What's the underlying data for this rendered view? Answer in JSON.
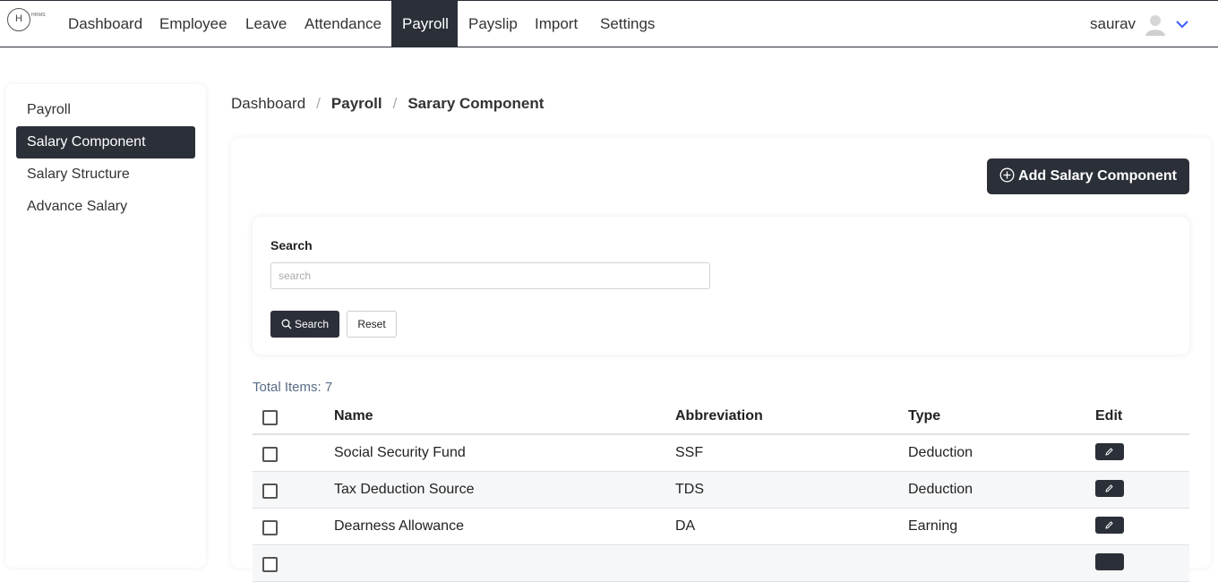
{
  "brand": {
    "logo_letter": "H",
    "logo_text": "HRMS"
  },
  "nav": {
    "items": [
      {
        "label": "Dashboard",
        "active": false
      },
      {
        "label": "Employee",
        "active": false
      },
      {
        "label": "Leave",
        "active": false
      },
      {
        "label": "Attendance",
        "active": false
      },
      {
        "label": "Payroll",
        "active": true
      },
      {
        "label": "Payslip",
        "active": false
      },
      {
        "label": "Import",
        "active": false
      },
      {
        "label": "Settings",
        "active": false
      }
    ],
    "user_name": "saurav"
  },
  "sidebar": {
    "items": [
      {
        "label": "Payroll",
        "active": false
      },
      {
        "label": "Salary Component",
        "active": true
      },
      {
        "label": "Salary Structure",
        "active": false
      },
      {
        "label": "Advance Salary",
        "active": false
      }
    ]
  },
  "breadcrumb": {
    "items": [
      "Dashboard",
      "Payroll",
      "Sarary Component"
    ]
  },
  "toolbar": {
    "add_label": "Add Salary Component"
  },
  "search": {
    "label": "Search",
    "placeholder": "search",
    "value": "",
    "search_button": "Search",
    "reset_button": "Reset"
  },
  "table": {
    "total_label": "Total Items: 7",
    "headers": {
      "name": "Name",
      "abbreviation": "Abbreviation",
      "type": "Type",
      "edit": "Edit"
    },
    "rows": [
      {
        "name": "Social Security Fund",
        "abbreviation": "SSF",
        "type": "Deduction"
      },
      {
        "name": "Tax Deduction Source",
        "abbreviation": "TDS",
        "type": "Deduction"
      },
      {
        "name": "Dearness Allowance",
        "abbreviation": "DA",
        "type": "Earning"
      }
    ]
  },
  "colors": {
    "dark": "#2b2f38",
    "accent_chevron": "#3d5afe",
    "muted_text": "#5a6c86"
  }
}
